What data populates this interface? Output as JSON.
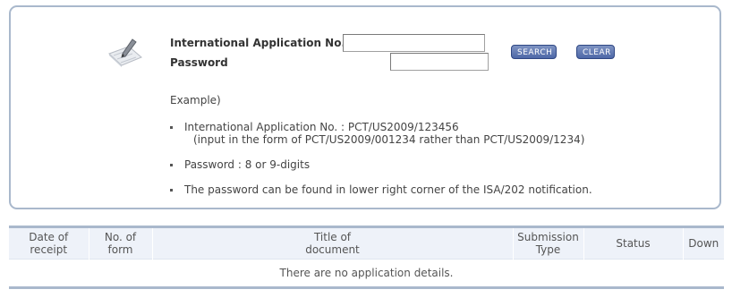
{
  "search": {
    "app_no_label": "International Application No.",
    "password_label": "Password",
    "app_no_value": "",
    "password_value": "",
    "search_button": "SEARCH",
    "clear_button": "CLEAR",
    "icon": "pen-on-paper-icon"
  },
  "example": {
    "title": "Example)",
    "app_no_line": "International Application No. : PCT/US2009/123456",
    "app_no_sub": "(input in the form of PCT/US2009/001234 rather than PCT/US2009/1234)",
    "password_line": "Password : 8 or 9-digits",
    "note_line": "The password can be found in lower right corner of the ISA/202 notification."
  },
  "table": {
    "columns": [
      {
        "line1": "Date of",
        "line2": "receipt"
      },
      {
        "line1": "No. of",
        "line2": "form"
      },
      {
        "line1": "Title of",
        "line2": "document"
      },
      {
        "line1": "Submission",
        "line2": "Type"
      },
      {
        "line1": "Status",
        "line2": ""
      },
      {
        "line1": "Down",
        "line2": ""
      }
    ],
    "empty_message": "There are no application details."
  },
  "colors": {
    "border": "#a9b8cc",
    "header_bg": "#eef2f9",
    "button": "#4e68a8"
  }
}
